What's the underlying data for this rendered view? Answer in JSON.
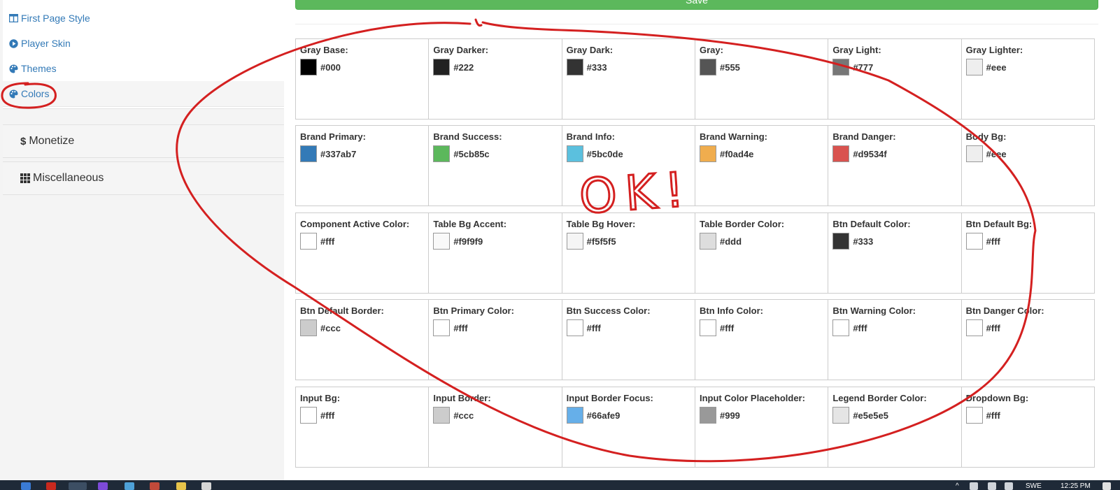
{
  "sidebar": {
    "links": [
      {
        "label": "First Page Style",
        "icon": "layout-columns-icon"
      },
      {
        "label": "Player Skin",
        "icon": "play-circle-icon"
      },
      {
        "label": "Themes",
        "icon": "palette-icon"
      },
      {
        "label": "Colors",
        "icon": "palette-icon"
      }
    ],
    "groups": [
      {
        "label": "Monetize",
        "icon": "dollar-icon",
        "glyph": "$"
      },
      {
        "label": "Miscellaneous",
        "icon": "grid-icon"
      }
    ]
  },
  "main": {
    "save_label": "Save"
  },
  "colors": [
    [
      {
        "label": "Gray Base:",
        "value": "#000",
        "color": "#000000"
      },
      {
        "label": "Gray Darker:",
        "value": "#222",
        "color": "#222222"
      },
      {
        "label": "Gray Dark:",
        "value": "#333",
        "color": "#333333"
      },
      {
        "label": "Gray:",
        "value": "#555",
        "color": "#555555"
      },
      {
        "label": "Gray Light:",
        "value": "#777",
        "color": "#777777"
      },
      {
        "label": "Gray Lighter:",
        "value": "#eee",
        "color": "#eeeeee"
      }
    ],
    [
      {
        "label": "Brand Primary:",
        "value": "#337ab7",
        "color": "#337ab7"
      },
      {
        "label": "Brand Success:",
        "value": "#5cb85c",
        "color": "#5cb85c"
      },
      {
        "label": "Brand Info:",
        "value": "#5bc0de",
        "color": "#5bc0de"
      },
      {
        "label": "Brand Warning:",
        "value": "#f0ad4e",
        "color": "#f0ad4e"
      },
      {
        "label": "Brand Danger:",
        "value": "#d9534f",
        "color": "#d9534f"
      },
      {
        "label": "Body Bg:",
        "value": "#eee",
        "color": "#eeeeee"
      }
    ],
    [
      {
        "label": "Component Active Color:",
        "value": "#fff",
        "color": "#ffffff"
      },
      {
        "label": "Table Bg Accent:",
        "value": "#f9f9f9",
        "color": "#f9f9f9"
      },
      {
        "label": "Table Bg Hover:",
        "value": "#f5f5f5",
        "color": "#f5f5f5"
      },
      {
        "label": "Table Border Color:",
        "value": "#ddd",
        "color": "#dddddd"
      },
      {
        "label": "Btn Default Color:",
        "value": "#333",
        "color": "#333333"
      },
      {
        "label": "Btn Default Bg:",
        "value": "#fff",
        "color": "#ffffff"
      }
    ],
    [
      {
        "label": "Btn Default Border:",
        "value": "#ccc",
        "color": "#cccccc"
      },
      {
        "label": "Btn Primary Color:",
        "value": "#fff",
        "color": "#ffffff"
      },
      {
        "label": "Btn Success Color:",
        "value": "#fff",
        "color": "#ffffff"
      },
      {
        "label": "Btn Info Color:",
        "value": "#fff",
        "color": "#ffffff"
      },
      {
        "label": "Btn Warning Color:",
        "value": "#fff",
        "color": "#ffffff"
      },
      {
        "label": "Btn Danger Color:",
        "value": "#fff",
        "color": "#ffffff"
      }
    ],
    [
      {
        "label": "Input Bg:",
        "value": "#fff",
        "color": "#ffffff"
      },
      {
        "label": "Input Border:",
        "value": "#ccc",
        "color": "#cccccc"
      },
      {
        "label": "Input Border Focus:",
        "value": "#66afe9",
        "color": "#66afe9"
      },
      {
        "label": "Input Color Placeholder:",
        "value": "#999",
        "color": "#999999"
      },
      {
        "label": "Legend Border Color:",
        "value": "#e5e5e5",
        "color": "#e5e5e5"
      },
      {
        "label": "Dropdown Bg:",
        "value": "#fff",
        "color": "#ffffff"
      }
    ]
  ],
  "annotation": {
    "text": "OK!",
    "ink_color": "#d42020"
  },
  "taskbar": {
    "language": "SWE",
    "time": "12:25 PM"
  },
  "theme": {
    "link_color": "#337ab7",
    "save_color": "#5cb85c"
  }
}
